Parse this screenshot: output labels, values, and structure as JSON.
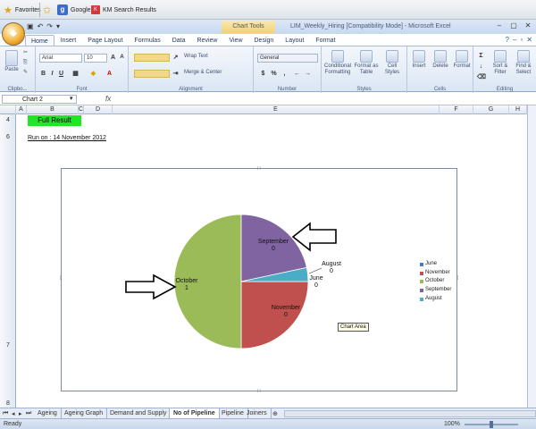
{
  "favorites_bar": {
    "favorites_label": "Favorites",
    "google_label": "Google",
    "km_label": "KM Search Results"
  },
  "title_bar": {
    "context_tab": "Chart Tools",
    "document_title": "LIM_Weekly_Hiring  [Compatibility Mode] - Microsoft Excel"
  },
  "ribbon_tabs": [
    "Home",
    "Insert",
    "Page Layout",
    "Formulas",
    "Data",
    "Review",
    "View",
    "Design",
    "Layout",
    "Format"
  ],
  "ribbon": {
    "clipboard": {
      "paste": "Paste",
      "label": "Clipbo..."
    },
    "font": {
      "name": "Arial",
      "size": "10",
      "label": "Font"
    },
    "alignment": {
      "wrap": "Wrap Text",
      "merge": "Merge & Center",
      "label": "Alignment"
    },
    "number": {
      "format": "General",
      "label": "Number"
    },
    "styles": {
      "conditional": "Conditional Formatting",
      "format_table": "Format as Table",
      "cell_styles": "Cell Styles",
      "label": "Styles"
    },
    "cells": {
      "insert": "Insert",
      "delete": "Delete",
      "format": "Format",
      "label": "Cells"
    },
    "editing": {
      "sort": "Sort & Filter",
      "find": "Find & Select",
      "label": "Editing"
    }
  },
  "formula_bar": {
    "name_box": "Chart 2",
    "fx": "fx"
  },
  "columns": [
    "A",
    "B",
    "C",
    "D",
    "E",
    "F",
    "G",
    "H"
  ],
  "rows": [
    "4",
    "6",
    "7",
    "8"
  ],
  "sheet": {
    "full_result": "Full Result",
    "run_on": "Run on :  14 November 2012"
  },
  "chart_data": {
    "type": "pie",
    "slices": [
      {
        "name": "June",
        "value": 0,
        "color": "#4a7ebb"
      },
      {
        "name": "November",
        "value": 0,
        "color": "#c0504d"
      },
      {
        "name": "October",
        "value": 1,
        "color": "#9bbb59"
      },
      {
        "name": "September",
        "value": 0,
        "color": "#8064a2"
      },
      {
        "name": "August",
        "value": 0,
        "color": "#4bacc6"
      }
    ],
    "data_labels": [
      {
        "name": "September",
        "value": "0"
      },
      {
        "name": "August",
        "value": "0"
      },
      {
        "name": "June",
        "value": "0"
      },
      {
        "name": "November",
        "value": "0"
      },
      {
        "name": "October",
        "value": "1"
      }
    ],
    "legend": [
      "June",
      "November",
      "October",
      "September",
      "August"
    ],
    "legend_position": "right"
  },
  "tooltip": "Chart Area",
  "sheet_tabs": [
    "Ageing",
    "Ageing Graph",
    "Demand and Supply",
    "No of Pipeline",
    "Pipeline",
    "Joiners"
  ],
  "active_sheet": "No of Pipeline",
  "status": {
    "ready": "Ready",
    "zoom": "100%"
  }
}
